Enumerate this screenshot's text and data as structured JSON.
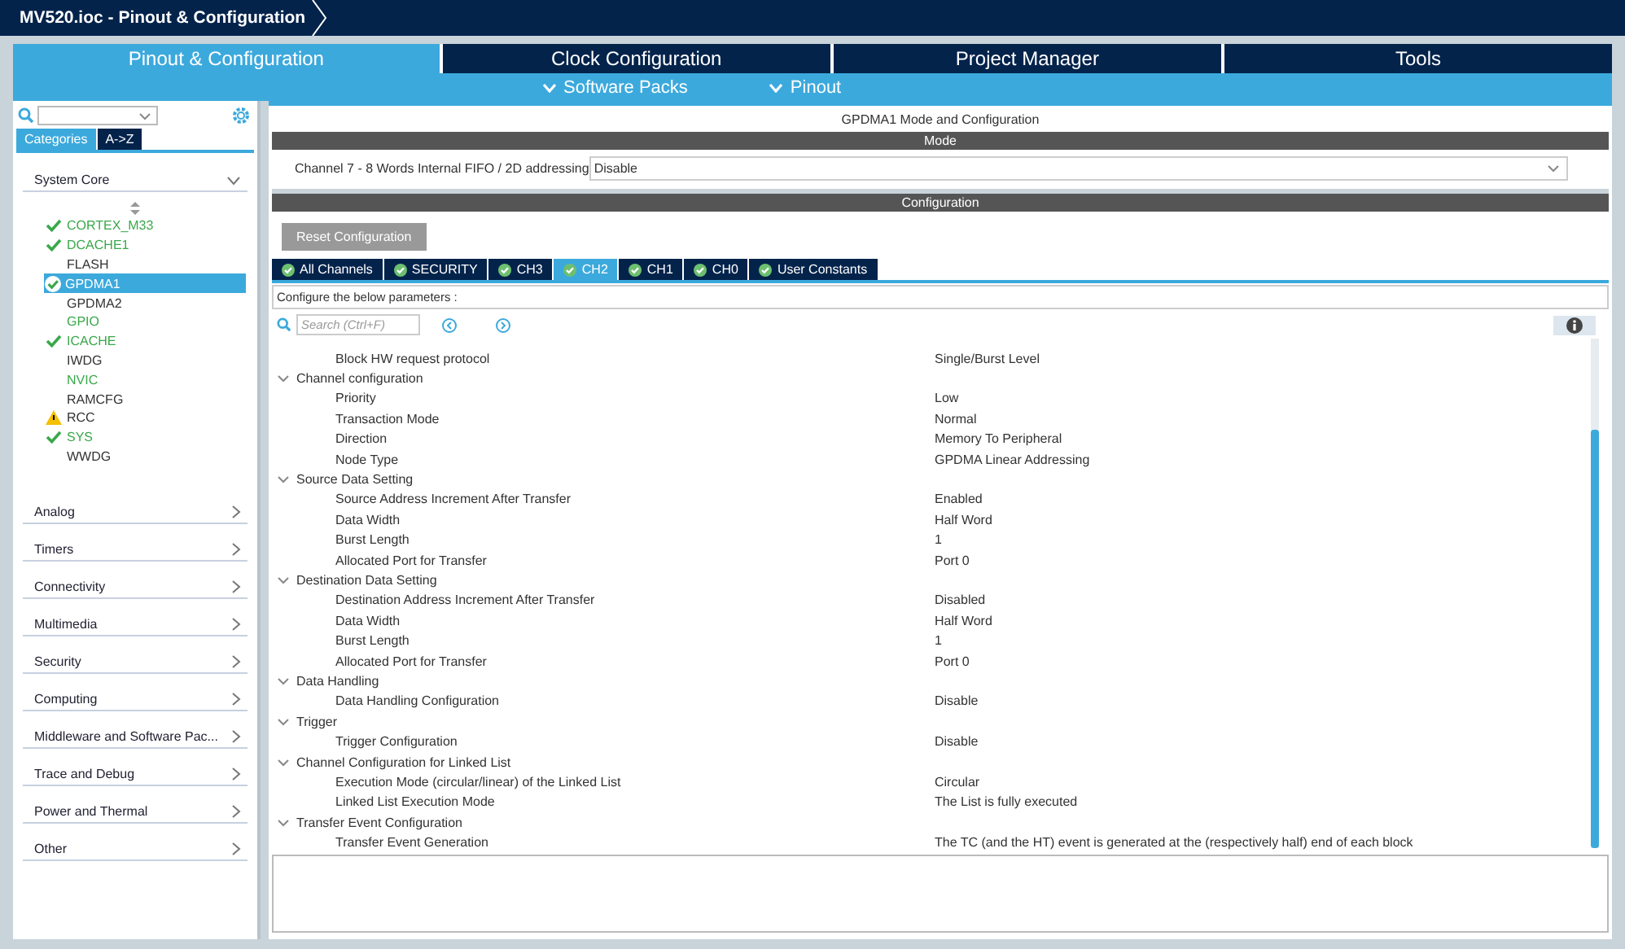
{
  "window": {
    "title": "MV520.ioc - Pinout & Configuration"
  },
  "main_tabs": [
    {
      "label": "Pinout & Configuration",
      "selected": true
    },
    {
      "label": "Clock Configuration",
      "selected": false
    },
    {
      "label": "Project Manager",
      "selected": false
    },
    {
      "label": "Tools",
      "selected": false
    }
  ],
  "sub_menus": [
    "Software Packs",
    "Pinout"
  ],
  "sidebar": {
    "view_tabs": [
      {
        "label": "Categories",
        "selected": true
      },
      {
        "label": "A->Z",
        "selected": false
      }
    ],
    "expanded_category": "System Core",
    "items": [
      {
        "label": "CORTEX_M33",
        "kind": "ok",
        "configured": true,
        "selected": false
      },
      {
        "label": "DCACHE1",
        "kind": "ok",
        "configured": true,
        "selected": false
      },
      {
        "label": "FLASH",
        "kind": "plain",
        "configured": false,
        "selected": false
      },
      {
        "label": "GPDMA1",
        "kind": "ok",
        "configured": true,
        "selected": true
      },
      {
        "label": "GPDMA2",
        "kind": "plain",
        "configured": false,
        "selected": false
      },
      {
        "label": "GPIO",
        "kind": "plain",
        "configured": true,
        "selected": false
      },
      {
        "label": "ICACHE",
        "kind": "ok",
        "configured": true,
        "selected": false
      },
      {
        "label": "IWDG",
        "kind": "plain",
        "configured": false,
        "selected": false
      },
      {
        "label": "NVIC",
        "kind": "plain",
        "configured": true,
        "selected": false
      },
      {
        "label": "RAMCFG",
        "kind": "plain",
        "configured": false,
        "selected": false
      },
      {
        "label": "RCC",
        "kind": "warning",
        "configured": false,
        "selected": false
      },
      {
        "label": "SYS",
        "kind": "ok",
        "configured": true,
        "selected": false
      },
      {
        "label": "WWDG",
        "kind": "plain",
        "configured": false,
        "selected": false
      }
    ],
    "categories": [
      "Analog",
      "Timers",
      "Connectivity",
      "Multimedia",
      "Security",
      "Computing",
      "Middleware and Software Pac...",
      "Trace and Debug",
      "Power and Thermal",
      "Other"
    ]
  },
  "panel": {
    "title": "GPDMA1 Mode and Configuration",
    "mode_header": "Mode",
    "mode_field": {
      "label": "Channel 7  - 8 Words Internal FIFO / 2D addressing",
      "value": "Disable"
    },
    "config_header": "Configuration",
    "reset_button": "Reset Configuration",
    "tabs": [
      {
        "label": "All Channels",
        "selected": false
      },
      {
        "label": "SECURITY",
        "selected": false
      },
      {
        "label": "CH3",
        "selected": false
      },
      {
        "label": "CH2",
        "selected": true
      },
      {
        "label": "CH1",
        "selected": false
      },
      {
        "label": "CH0",
        "selected": false
      },
      {
        "label": "User Constants",
        "selected": false
      }
    ],
    "hint": "Configure the below parameters :",
    "search": {
      "placeholder": "Search (Ctrl+F)"
    },
    "tree": [
      {
        "kind": "param",
        "label": "Block HW request protocol",
        "value": "Single/Burst Level"
      },
      {
        "kind": "group",
        "label": "Channel configuration",
        "expanded": true,
        "children": [
          {
            "label": "Priority",
            "value": "Low"
          },
          {
            "label": "Transaction Mode",
            "value": "Normal"
          },
          {
            "label": "Direction",
            "value": "Memory To Peripheral"
          },
          {
            "label": "Node Type",
            "value": "GPDMA Linear Addressing"
          }
        ]
      },
      {
        "kind": "group",
        "label": "Source Data Setting",
        "expanded": true,
        "children": [
          {
            "label": "Source Address Increment After Transfer",
            "value": "Enabled"
          },
          {
            "label": "Data Width",
            "value": "Half Word"
          },
          {
            "label": "Burst Length",
            "value": "1"
          },
          {
            "label": "Allocated Port for Transfer",
            "value": "Port 0"
          }
        ]
      },
      {
        "kind": "group",
        "label": "Destination Data Setting",
        "expanded": true,
        "children": [
          {
            "label": "Destination Address Increment After Transfer",
            "value": "Disabled"
          },
          {
            "label": "Data Width",
            "value": "Half Word"
          },
          {
            "label": "Burst Length",
            "value": "1"
          },
          {
            "label": "Allocated Port for Transfer",
            "value": "Port 0"
          }
        ]
      },
      {
        "kind": "group",
        "label": "Data Handling",
        "expanded": true,
        "children": [
          {
            "label": "Data Handling Configuration",
            "value": "Disable"
          }
        ]
      },
      {
        "kind": "group",
        "label": "Trigger",
        "expanded": true,
        "children": [
          {
            "label": "Trigger Configuration",
            "value": "Disable"
          }
        ]
      },
      {
        "kind": "group",
        "label": "Channel Configuration for Linked List",
        "expanded": true,
        "children": [
          {
            "label": "Execution Mode (circular/linear) of the Linked List",
            "value": "Circular"
          },
          {
            "label": "Linked List Execution Mode",
            "value": "The List is fully executed"
          }
        ]
      },
      {
        "kind": "group",
        "label": "Transfer Event Configuration",
        "expanded": true,
        "children": [
          {
            "label": "Transfer Event Generation",
            "value": "The TC (and the HT) event is generated at the (respectively half) end of each block"
          }
        ]
      }
    ]
  }
}
